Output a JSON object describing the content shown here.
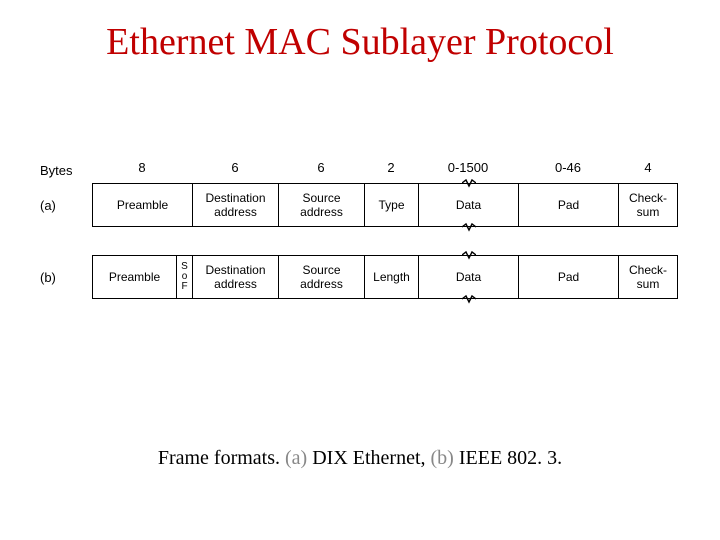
{
  "title": "Ethernet MAC Sublayer Protocol",
  "bytes_label": "Bytes",
  "row_a_label": "(a)",
  "row_b_label": "(b)",
  "bytes": {
    "preamble": "8",
    "dest": "6",
    "src": "6",
    "type": "2",
    "data": "0-1500",
    "pad": "0-46",
    "chk": "4"
  },
  "frame_a": {
    "preamble": "Preamble",
    "dest": "Destination address",
    "src": "Source address",
    "type": "Type",
    "data": "Data",
    "pad": "Pad",
    "chk": "Check-sum"
  },
  "frame_b": {
    "preamble": "Preamble",
    "sof": "S o F",
    "dest": "Destination address",
    "src": "Source address",
    "length": "Length",
    "data": "Data",
    "pad": "Pad",
    "chk": "Check-sum"
  },
  "caption": {
    "pre": "Frame formats. ",
    "a": "(a)",
    "mid1": " DIX Ethernet,  ",
    "b": "(b)",
    "mid2": " IEEE 802. 3."
  }
}
